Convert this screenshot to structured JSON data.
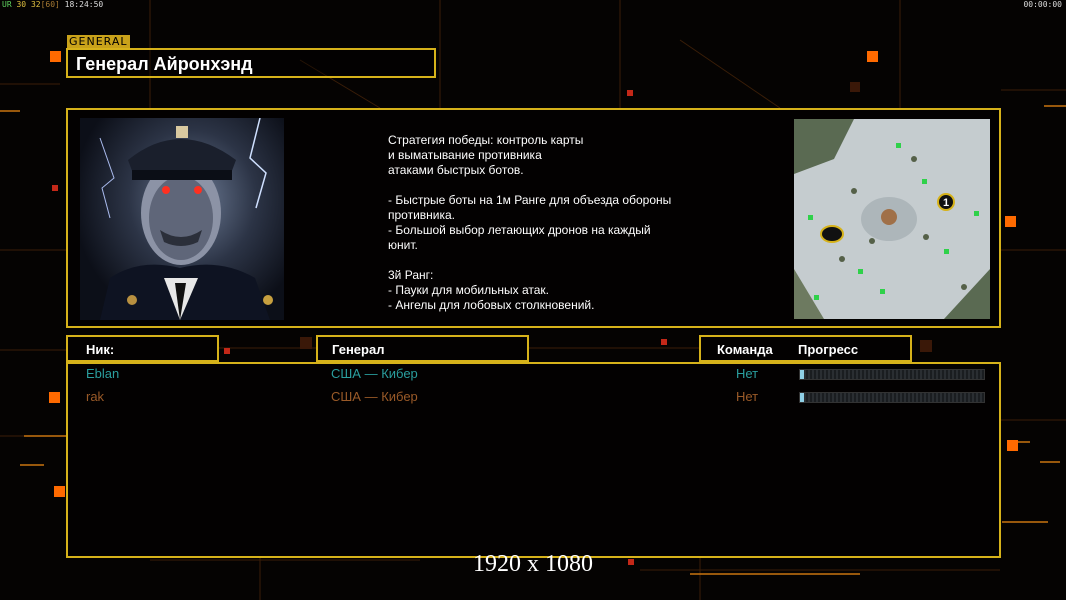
{
  "hud": {
    "left_prefix": "UR",
    "fps": "30",
    "fps_cap": "32",
    "fps_target": "[60]",
    "clock": "18:24:50",
    "right_timer": "00:00:00"
  },
  "general": {
    "tag": "GENERAL",
    "name": "Генерал Айронхэнд"
  },
  "strategy_text": "Стратегия победы: контроль карты\nи выматывание противника\nатаками быстрых ботов.\n\n- Быстрые боты на 1м Ранге для объезда обороны\n противника.\n- Большой выбор летающих дронов на каждый\n юнит.\n\n3й Ранг:\n- Пауки для мобильных атак.\n- Ангелы для лобовых столкновений.",
  "columns": {
    "nick": "Ник:",
    "general": "Генерал",
    "team": "Команда",
    "progress": "Прогресс"
  },
  "players": [
    {
      "nick": "Eblan",
      "general": "США — Кибер",
      "team": "Нет",
      "progress": 0.01,
      "color": "#2a9e9e"
    },
    {
      "nick": "rak",
      "general": "США — Кибер",
      "team": "Нет",
      "progress": 0.01,
      "color": "#9a5a28"
    }
  ],
  "map": {
    "start_marker": "1"
  },
  "resolution_label": "1920 x 1080",
  "colors": {
    "accent": "#d6b21a",
    "orange": "#ff6a00"
  }
}
